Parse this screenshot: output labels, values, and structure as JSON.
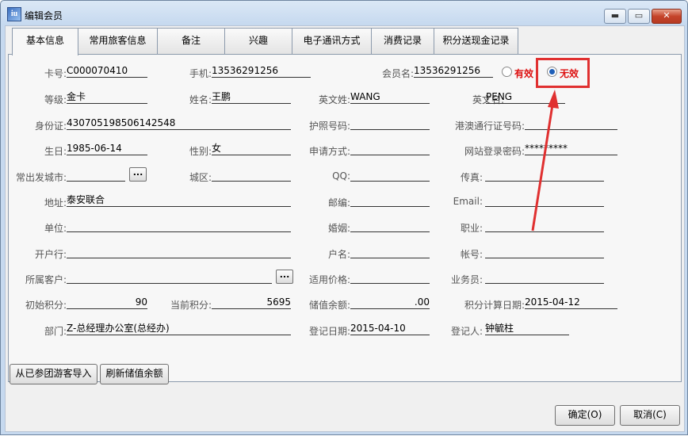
{
  "window": {
    "title": "编辑会员"
  },
  "tabs": [
    "基本信息",
    "常用旅客信息",
    "备注",
    "兴趣",
    "电子通讯方式",
    "消费记录",
    "积分送现金记录"
  ],
  "labels": {
    "card_no": "卡号:",
    "mobile": "手机:",
    "member_name": "会员名:",
    "level": "等级:",
    "name": "姓名:",
    "en_last": "英文姓:",
    "en_first": "英文名:",
    "id_card": "身份证:",
    "passport": "护照号码:",
    "hk_pass": "港澳通行证号码:",
    "birthday": "生日:",
    "gender": "性别:",
    "apply": "申请方式:",
    "web_pwd": "网站登录密码:",
    "city": "常出发城市:",
    "district": "城区:",
    "qq": "QQ:",
    "fax": "传真:",
    "address": "地址:",
    "postcode": "邮编:",
    "email": "Email:",
    "unit": "单位:",
    "marriage": "婚姻:",
    "job": "职业:",
    "bank": "开户行:",
    "account_name": "户名:",
    "account_no": "帐号:",
    "customer": "所属客户:",
    "price": "适用价格:",
    "salesman": "业务员:",
    "init_points": "初始积分:",
    "cur_points": "当前积分:",
    "balance": "储值余额:",
    "points_date": "积分计算日期:",
    "dept": "部门:",
    "reg_date": "登记日期:",
    "registrar": "登记人:"
  },
  "values": {
    "card_no": "C000070410",
    "mobile": "13536291256",
    "member_name": "13536291256",
    "level": "金卡",
    "name": "王鹏",
    "en_last": "WANG",
    "en_first": "PENG",
    "id_card": "430705198506142548",
    "passport": "",
    "hk_pass": "",
    "birthday": "1985-06-14",
    "gender": "女",
    "apply": "",
    "web_pwd": "*********",
    "city": "",
    "district": "",
    "qq": "",
    "fax": "",
    "address": "泰安联合",
    "postcode": "",
    "email": "",
    "unit": "",
    "marriage": "",
    "job": "",
    "bank": "",
    "account_name": "",
    "account_no": "",
    "customer": "",
    "price": "",
    "salesman": "",
    "init_points": "90",
    "cur_points": "5695",
    "balance": ".00",
    "points_date": "2015-04-12",
    "dept": "Z-总经理办公室(总经办)",
    "reg_date": "2015-04-10",
    "registrar": "钟毓柱"
  },
  "status": {
    "valid": "有效",
    "invalid": "无效",
    "selected": "无效"
  },
  "buttons": {
    "import": "从已参团游客导入",
    "refresh": "刷新储值余额",
    "ok": "确定(O)",
    "cancel": "取消(C)",
    "ellipsis": "..."
  },
  "window_controls": {
    "minimize": "▬",
    "maximize": "▭",
    "close": "✕"
  },
  "colors": {
    "highlight": "#e03030",
    "status_red": "#dd1111"
  }
}
